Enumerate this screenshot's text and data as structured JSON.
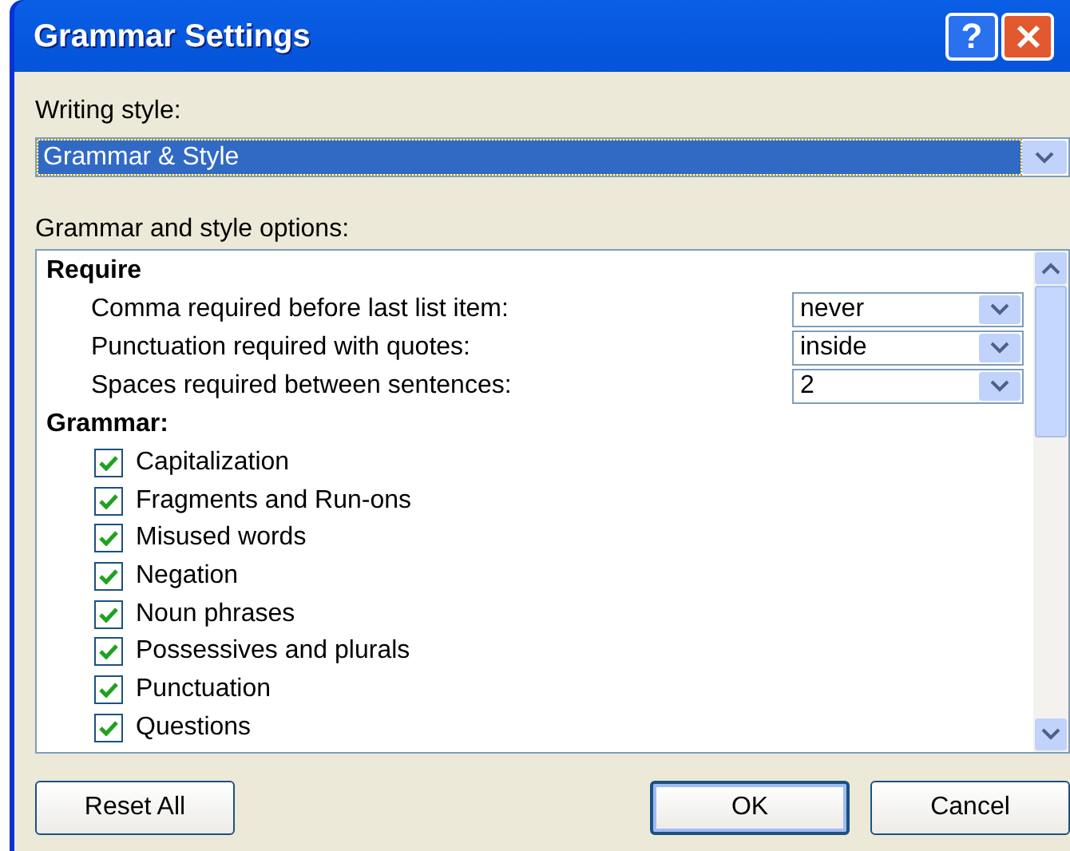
{
  "window": {
    "title": "Grammar Settings",
    "title_buttons": [
      {
        "kind": "help",
        "label": "?"
      },
      {
        "kind": "close"
      }
    ]
  },
  "writing_style": {
    "label": "Writing style:",
    "value": "Grammar & Style"
  },
  "options": {
    "label": "Grammar and style options:",
    "sections": [
      {
        "title": "Require",
        "items": [
          {
            "kind": "select",
            "label": "Comma required before last list item:",
            "value": "never"
          },
          {
            "kind": "select",
            "label": "Punctuation required with quotes:",
            "value": "inside"
          },
          {
            "kind": "select",
            "label": "Spaces required between sentences:",
            "value": "2"
          }
        ]
      },
      {
        "title": "Grammar:",
        "items": [
          {
            "kind": "checkbox",
            "label": "Capitalization",
            "checked": true
          },
          {
            "kind": "checkbox",
            "label": "Fragments and Run-ons",
            "checked": true
          },
          {
            "kind": "checkbox",
            "label": "Misused words",
            "checked": true
          },
          {
            "kind": "checkbox",
            "label": "Negation",
            "checked": true
          },
          {
            "kind": "checkbox",
            "label": "Noun phrases",
            "checked": true
          },
          {
            "kind": "checkbox",
            "label": "Possessives and plurals",
            "checked": true
          },
          {
            "kind": "checkbox",
            "label": "Punctuation",
            "checked": true
          },
          {
            "kind": "checkbox",
            "label": "Questions",
            "checked": true
          }
        ]
      }
    ]
  },
  "buttons": [
    {
      "kind": "reset",
      "label": "Reset All"
    },
    {
      "kind": "ok",
      "label": "OK",
      "selected": true
    },
    {
      "kind": "cancel",
      "label": "Cancel",
      "selected": false
    }
  ]
}
